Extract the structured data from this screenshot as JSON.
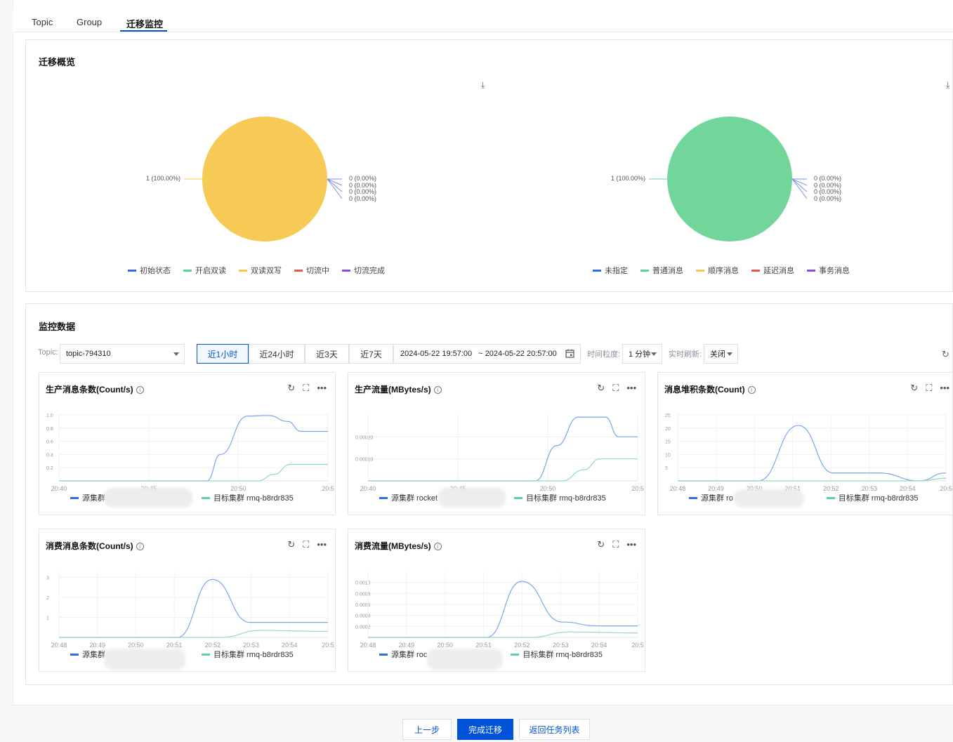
{
  "tabs": [
    {
      "label": "Topic"
    },
    {
      "label": "Group"
    },
    {
      "label": "迁移监控"
    }
  ],
  "overview": {
    "title": "迁移概览",
    "pie_left": {
      "main_label": "1 (100.00%)",
      "small_labels": [
        "0 (0.00%)",
        "0 (0.00%)",
        "0 (0.00%)",
        "0 (0.00%)"
      ],
      "legend": [
        {
          "name": "初始状态",
          "color": "#2f6ee8"
        },
        {
          "name": "开启双读",
          "color": "#5cd39a"
        },
        {
          "name": "双读双写",
          "color": "#f7c74f"
        },
        {
          "name": "切流中",
          "color": "#e5574b"
        },
        {
          "name": "切流完成",
          "color": "#8b4fe0"
        }
      ],
      "color": "#f7c955"
    },
    "pie_right": {
      "main_label": "1 (100.00%)",
      "small_labels": [
        "0 (0.00%)",
        "0 (0.00%)",
        "0 (0.00%)",
        "0 (0.00%)"
      ],
      "legend": [
        {
          "name": "未指定",
          "color": "#2f6ee8"
        },
        {
          "name": "普通消息",
          "color": "#5cd39a"
        },
        {
          "name": "顺序消息",
          "color": "#f7c74f"
        },
        {
          "name": "延迟消息",
          "color": "#e5574b"
        },
        {
          "name": "事务消息",
          "color": "#8b4fe0"
        }
      ],
      "color": "#72d69b"
    }
  },
  "monitor": {
    "title": "监控数据",
    "topic_label": "Topic:",
    "topic_value": "topic-794310",
    "ranges": [
      "近1小时",
      "近24小时",
      "近3天",
      "近7天"
    ],
    "active_range": "近1小时",
    "date_start": "2024-05-22 19:57:00",
    "date_end": "~ 2024-05-22 20:57:00",
    "granularity_label": "时间粒度:",
    "granularity_value": "1 分钟",
    "refresh_label": "实时刷新:",
    "refresh_value": "关闭"
  },
  "chart_data": [
    {
      "type": "line",
      "title": "生产消息条数(Count/s)",
      "x_ticks": [
        "20:40",
        "20:45",
        "20:50",
        "20:5"
      ],
      "y_ticks": [
        "1.0",
        "0.8",
        "0.6",
        "0.4",
        "0.2"
      ],
      "ylim": [
        0,
        1.0
      ],
      "series": [
        {
          "name": "源集群",
          "color": "#7aa6f0",
          "x": [
            0,
            0.55,
            0.6,
            0.7,
            0.78,
            0.85,
            0.9,
            1.0
          ],
          "y": [
            0,
            0,
            0.4,
            0.98,
            0.99,
            0.9,
            0.75,
            0.75
          ]
        },
        {
          "name": "目标集群 rmq-b8rdr835",
          "color": "#8fdcc0",
          "x": [
            0,
            0.74,
            0.8,
            0.86,
            1.0
          ],
          "y": [
            0,
            0,
            0.1,
            0.25,
            0.25
          ]
        }
      ],
      "legend": [
        "源集群",
        "目标集群 rmq-b8rdr835"
      ]
    },
    {
      "type": "line",
      "title": "生产流量(MBytes/s)",
      "x_ticks": [
        "20:40",
        "20:45",
        "20:50",
        "20:5"
      ],
      "y_ticks": [
        "0.00020",
        "0.00010"
      ],
      "ylim": [
        0,
        0.0003
      ],
      "series": [
        {
          "name": "源集群 rocket",
          "color": "#7aa6f0",
          "x": [
            0,
            0.62,
            0.7,
            0.78,
            0.88,
            0.93,
            1.0
          ],
          "y": [
            0,
            0,
            0.00016,
            0.00029,
            0.00029,
            0.0002,
            0.0002
          ]
        },
        {
          "name": "目标集群 rmq-b8rdr835",
          "color": "#8fdcc0",
          "x": [
            0,
            0.72,
            0.8,
            0.86,
            1.0
          ],
          "y": [
            0,
            0,
            5e-05,
            0.0001,
            0.0001
          ]
        }
      ],
      "legend": [
        "源集群 rocket",
        "目标集群 rmq-b8rdr835"
      ]
    },
    {
      "type": "line",
      "title": "消息堆积条数(Count)",
      "x_ticks": [
        "20:48",
        "20:49",
        "20:50",
        "20:51",
        "20:52",
        "20:53",
        "20:54",
        "20:5"
      ],
      "y_ticks": [
        "25",
        "20",
        "15",
        "10",
        "5"
      ],
      "ylim": [
        0,
        25
      ],
      "series": [
        {
          "name": "源集群 ro",
          "color": "#7aa6f0",
          "x": [
            0,
            0.3,
            0.45,
            0.58,
            0.75,
            0.9,
            1.0
          ],
          "y": [
            0,
            0,
            21,
            3,
            3,
            0,
            3
          ]
        },
        {
          "name": "目标集群 rmq-b8rdr835",
          "color": "#8fdcc0",
          "x": [
            0,
            0.7,
            0.9,
            1.0
          ],
          "y": [
            0,
            0,
            0,
            1
          ]
        }
      ],
      "legend": [
        "源集群 ro",
        "目标集群 rmq-b8rdr835"
      ]
    },
    {
      "type": "line",
      "title": "消费消息条数(Count/s)",
      "x_ticks": [
        "20:48",
        "20:49",
        "20:50",
        "20:51",
        "20:52",
        "20:53",
        "20:54",
        "20:5"
      ],
      "y_ticks": [
        "3",
        "2",
        "1"
      ],
      "ylim": [
        0,
        3.3
      ],
      "series": [
        {
          "name": "源集群",
          "color": "#7aa6f0",
          "x": [
            0,
            0.44,
            0.57,
            0.71,
            1.0
          ],
          "y": [
            0,
            0,
            2.9,
            0.75,
            0.75
          ]
        },
        {
          "name": "目标集群 rmq-b8rdr835",
          "color": "#8fdcc0",
          "x": [
            0,
            0.6,
            0.75,
            1.0
          ],
          "y": [
            0,
            0,
            0.35,
            0.3
          ]
        }
      ],
      "legend": [
        "源集群",
        "目标集群 rmq-b8rdr835"
      ]
    },
    {
      "type": "line",
      "title": "消费流量(MBytes/s)",
      "x_ticks": [
        "20:48",
        "20:49",
        "20:50",
        "20:51",
        "20:52",
        "20:53",
        "20:54",
        "20:5"
      ],
      "y_ticks": [
        "0.0010",
        "0.0008",
        "0.0006",
        "0.0004",
        "0.0002"
      ],
      "ylim": [
        0,
        0.0012
      ],
      "series": [
        {
          "name": "源集群 roc",
          "color": "#7aa6f0",
          "x": [
            0,
            0.44,
            0.57,
            0.72,
            0.85,
            1.0
          ],
          "y": [
            0,
            0,
            0.00102,
            0.00028,
            0.00021,
            0.00021
          ]
        },
        {
          "name": "目标集群 rmq-b8rdr835",
          "color": "#8fdcc0",
          "x": [
            0,
            0.6,
            0.75,
            1.0
          ],
          "y": [
            0,
            0,
            0.0001,
            8e-05
          ]
        }
      ],
      "legend": [
        "源集群 roc",
        "目标集群 rmq-b8rdr835"
      ]
    }
  ],
  "buttons": {
    "prev": "上一步",
    "finish": "完成迁移",
    "back": "返回任务列表"
  },
  "icons": {
    "refresh": "refresh-icon",
    "fullscreen": "fullscreen-icon",
    "more": "more-icon",
    "info": "info-icon",
    "download": "download-icon",
    "calendar": "calendar-icon"
  }
}
